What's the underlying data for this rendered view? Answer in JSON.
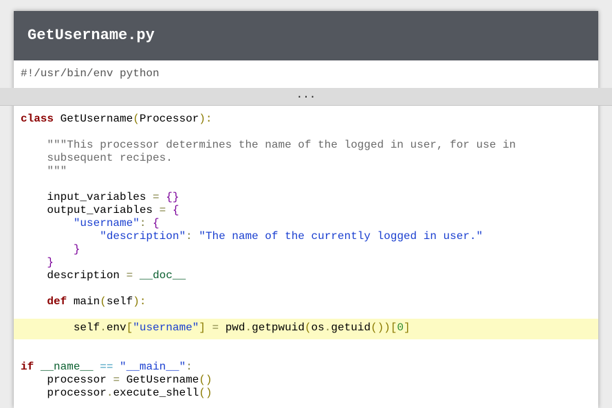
{
  "header": {
    "title": "GetUsername.py"
  },
  "code": {
    "shebang": "#!/usr/bin/env python",
    "fold_ellipsis": "...",
    "tokens": {
      "class_kw": "class",
      "class_name": "GetUsername",
      "paren_open": "(",
      "base_class": "Processor",
      "paren_close_colon": "):",
      "doc_line1": "\"\"\"This processor determines the name of the logged in user, for use in",
      "doc_line2": "subsequent recipes.",
      "doc_line3": "\"\"\"",
      "input_variables": "input_variables",
      "eq": "=",
      "empty_dict": "{}",
      "output_variables": "output_variables",
      "brace_open": "{",
      "username_key": "\"username\"",
      "colon": ":",
      "description_key": "\"description\"",
      "description_value": "\"The name of the currently logged in user.\"",
      "brace_close": "}",
      "description_attr": "description",
      "doc_dunder": "__doc__",
      "def_kw": "def",
      "main_name": "main",
      "self_param": "self",
      "self_env": "self",
      "dot": ".",
      "env_attr": "env",
      "bracket_open": "[",
      "bracket_close": "]",
      "pwd_mod": "pwd",
      "getpwuid": "getpwuid",
      "os_mod": "os",
      "getuid": "getuid",
      "call_parens": "())",
      "index_zero": "0",
      "if_kw": "if",
      "name_dunder": "__name__",
      "eqeq": "==",
      "main_str": "\"__main__\"",
      "processor_var": "processor",
      "class_call": "GetUsername",
      "empty_call": "()",
      "execute_shell": "execute_shell"
    }
  },
  "colors": {
    "header_bg": "#53575e",
    "fold_bar_bg": "#dcdcdc",
    "highlight_bg": "#fdfbc3",
    "keyword": "#8b0000",
    "string": "#1a3fd0"
  }
}
